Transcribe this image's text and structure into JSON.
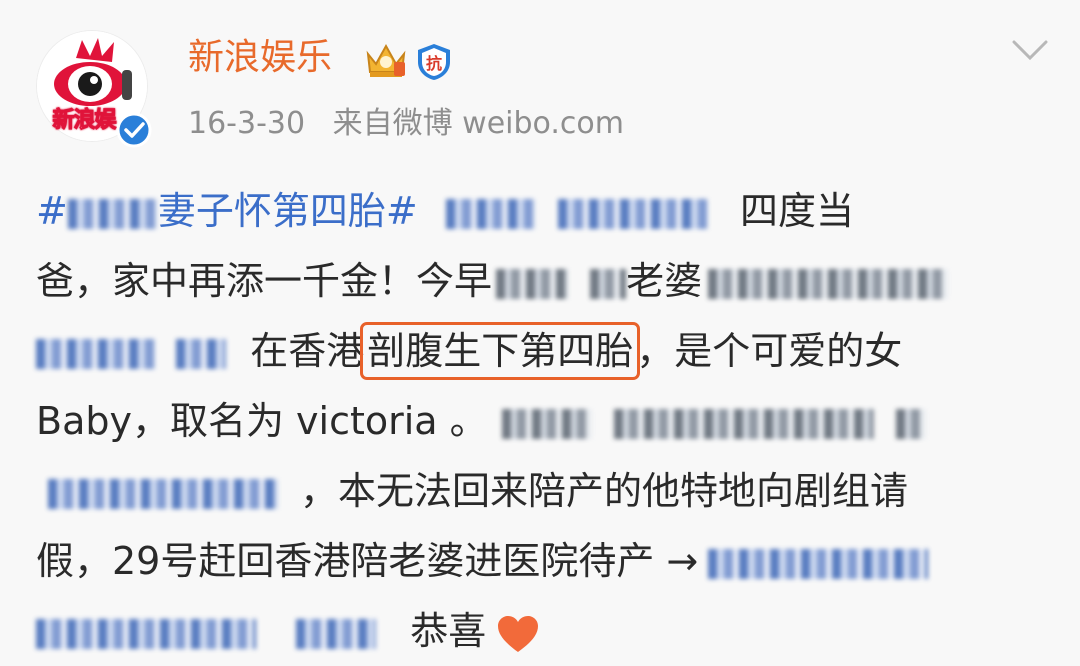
{
  "account": {
    "name": "新浪娱乐",
    "avatar_text": "新浪娱",
    "date": "16-3-30",
    "source": "来自微博 weibo.com"
  },
  "post": {
    "line1": {
      "topic_start": "#",
      "topic_end": "妻子怀第四胎#",
      "text": "四度当"
    },
    "line2": {
      "text_a": "爸，家中再添一千金！今早",
      "text_b": "老婆"
    },
    "line3": {
      "text_a": "在香港",
      "highlight": "剖腹生下第四胎",
      "text_b": "，是个可爱的女"
    },
    "line4": {
      "text": "Baby，取名为 victoria 。"
    },
    "line5": {
      "text": "，本无法回来陪产的他特地向剧组请"
    },
    "line6": {
      "text": "假，29号赶回香港陪老婆进医院待产 →"
    },
    "line7": {
      "text": "恭喜"
    }
  },
  "icons": {
    "crown": "crown-badge-icon",
    "shield": "anti-badge-icon",
    "shield_text": "抗",
    "verified": "verified-check-icon",
    "chevron": "chevron-down-icon",
    "heart": "heart-icon"
  },
  "colors": {
    "name": "#e86a2b",
    "topic": "#3b6ec9",
    "highlight_border": "#e8612a",
    "verified": "#2a7fd9",
    "heart": "#f26a3a"
  }
}
